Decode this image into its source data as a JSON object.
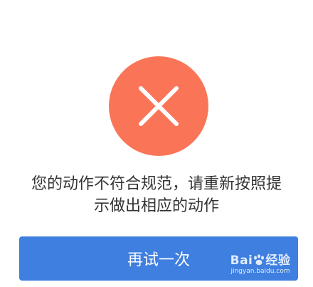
{
  "error": {
    "icon": "close-icon",
    "color": "#fa7558"
  },
  "message": {
    "line1": "您的动作不符合规范，请重新按照提",
    "line2": "示做出相应的动作"
  },
  "retry_button": {
    "label": "再试一次",
    "color": "#3e7fe0"
  },
  "watermark": {
    "brand": "Bai",
    "suffix": "经验",
    "url": "jingyan.baidu.com"
  }
}
